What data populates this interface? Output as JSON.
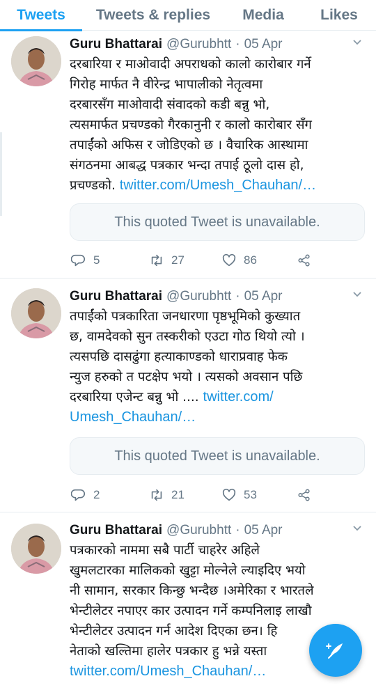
{
  "tabs": [
    "Tweets",
    "Tweets & replies",
    "Media",
    "Likes"
  ],
  "colors": {
    "accent": "#1da1f2",
    "link": "#1b95e0",
    "muted": "#657786",
    "text": "#14171a"
  },
  "tweets": [
    {
      "name": "Guru Bhattarai",
      "handle": "@Gurubhtt",
      "sep": "·",
      "date": "05 Apr",
      "lines": [
        "दरबारिया र माओवादी अपराधको कालो कारोबार गर्ने",
        "गिरोह मार्फत नै वीरेन्द्र भापालीको नेतृत्वमा",
        "दरबारसँग माओवादी संवादको कडी बन्नु भो,",
        "त्यसमार्फत प्रचण्डको गैरकानुनी र कालो कारोबार सँग",
        "तपाईंको अफिस र जोडिएको छ । वैचारिक आस्थामा",
        "संगठनमा आबद्ध पत्रकार भन्दा तपाई ठूलो दास हो,"
      ],
      "last_text": "प्रचण्डको. ",
      "last_link": "twitter.com/Umesh_Chauhan/…",
      "quote": "This quoted Tweet is unavailable.",
      "replies": "5",
      "retweets": "27",
      "likes": "86"
    },
    {
      "name": "Guru Bhattarai",
      "handle": "@Gurubhtt",
      "sep": "·",
      "date": "05 Apr",
      "lines": [
        "तपाईंको पत्रकारिता जनधारणा पृष्ठभूमिको कुख्यात",
        "छ, वामदेवको सुन तस्करीको एउटा गोठ थियो त्यो ।",
        "त्यसपछि दासढुंगा हत्याकाण्डको धाराप्रवाह फेक",
        "न्युज हरुको त पटक्षेप भयो । त्यसको अवसान पछि"
      ],
      "line5_text": "दरबारिया एजेन्ट बन्नु भो .... ",
      "line5_link": "twitter.com/",
      "line6_link": "Umesh_Chauhan/…",
      "quote": "This quoted Tweet is unavailable.",
      "replies": "2",
      "retweets": "21",
      "likes": "53"
    },
    {
      "name": "Guru Bhattarai",
      "handle": "@Gurubhtt",
      "sep": "·",
      "date": "05 Apr",
      "lines": [
        "पत्रकारको नाममा सबै पार्टी चाहरेर अहिले",
        "खुमलटारका मालिकको खुट्टा मोल्नेले ल्याइदिए भयो",
        "नी सामान, सरकार किन्छु भन्दैछ ।अमेरिका र भारतले",
        "भेन्टीलेटर नपाएर कार उत्पादन गर्ने कम्पनिलाइ लाखौ",
        "भेन्टीलेटर उत्पादन गर्न आदेश दिएका छन। हि",
        "नेताको खल्तिमा हालेर पत्रकार हु भन्ने यस्ता"
      ],
      "last_link": "twitter.com/Umesh_Chauhan/…"
    }
  ]
}
